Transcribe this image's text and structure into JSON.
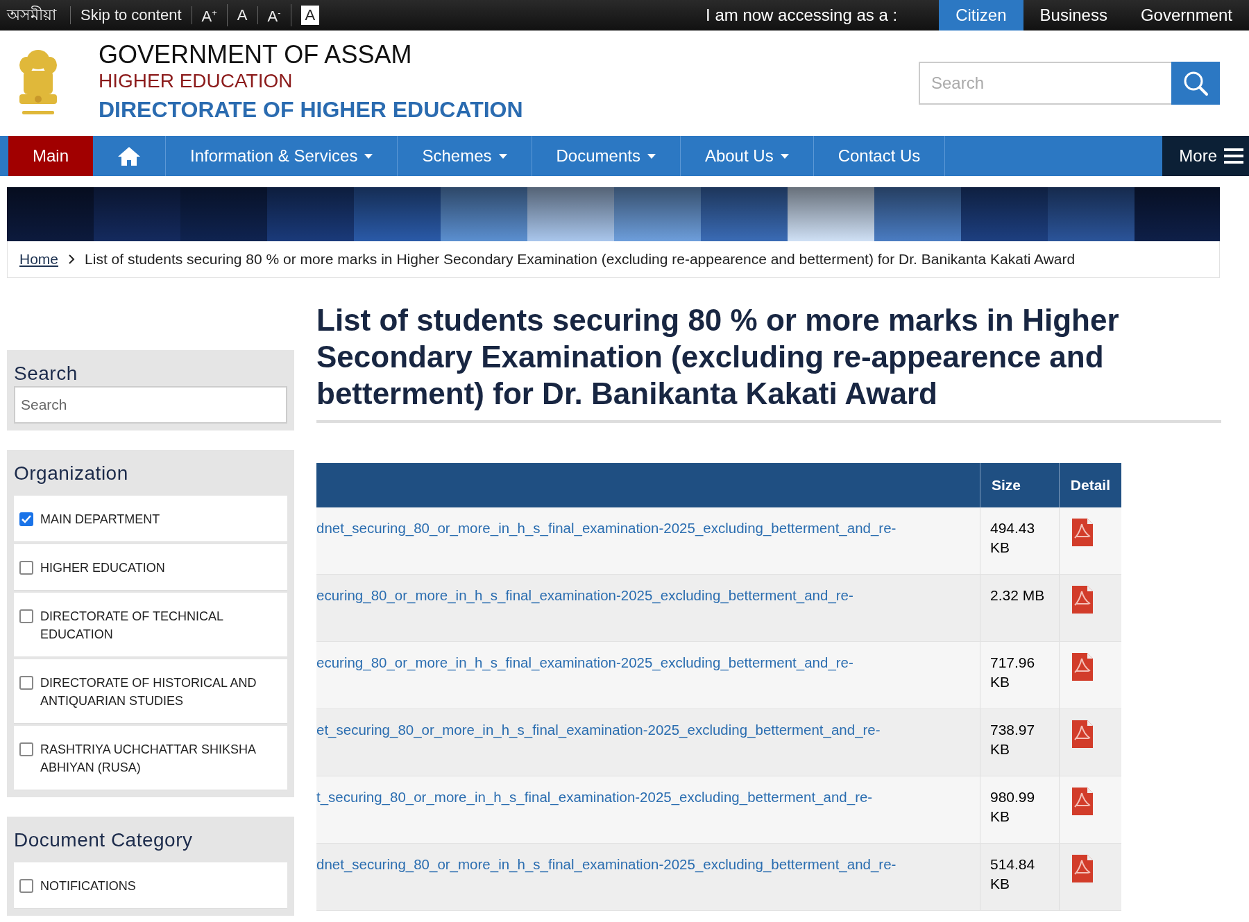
{
  "top_bar": {
    "language": "অসমীয়া",
    "skip_link": "Skip to content",
    "font_controls": [
      {
        "label": "A$^{+}$",
        "kind": "plain"
      },
      {
        "label": "A",
        "kind": "plain"
      },
      {
        "label": "A$^{-}$",
        "kind": "plain"
      },
      {
        "label": "A",
        "kind": "contrast"
      }
    ],
    "audience_prompt": "I am now accessing as a :",
    "audiences": [
      {
        "label": "Citizen",
        "selected": true
      },
      {
        "label": "Business",
        "selected": false
      },
      {
        "label": "Government",
        "selected": false
      }
    ]
  },
  "header": {
    "title": "GOVERNMENT OF ASSAM",
    "department": "HIGHER EDUCATION",
    "directorate": "DIRECTORATE OF HIGHER EDUCATION",
    "search": {
      "placeholder": "Search"
    }
  },
  "nav": {
    "items": [
      {
        "kind": "text",
        "label": "Main",
        "selected": true,
        "dropdown": false
      },
      {
        "kind": "home",
        "selected": false,
        "dropdown": false
      },
      {
        "kind": "text",
        "label": "Information & Services",
        "selected": false,
        "dropdown": true
      },
      {
        "kind": "text",
        "label": "Schemes",
        "selected": false,
        "dropdown": true
      },
      {
        "kind": "text",
        "label": "Documents",
        "selected": false,
        "dropdown": true
      },
      {
        "kind": "text",
        "label": "About Us",
        "selected": false,
        "dropdown": true
      },
      {
        "kind": "text",
        "label": "Contact Us",
        "selected": false,
        "dropdown": false
      }
    ],
    "more": "More"
  },
  "breadcrumb": {
    "home": "Home",
    "current": "List of students securing 80 % or more marks in Higher Secondary Examination (excluding re-appearence and betterment) for Dr. Banikanta Kakati Award"
  },
  "sidebar": {
    "search": {
      "heading": "Search",
      "placeholder": "Search"
    },
    "organization": {
      "heading": "Organization",
      "items": [
        {
          "label": "MAIN DEPARTMENT",
          "checked": true
        },
        {
          "label": "HIGHER EDUCATION",
          "checked": false
        },
        {
          "label": "DIRECTORATE OF TECHNICAL EDUCATION",
          "checked": false
        },
        {
          "label": "DIRECTORATE OF HISTORICAL AND ANTIQUARIAN STUDIES",
          "checked": false
        },
        {
          "label": "RASHTRIYA UCHCHATTAR SHIKSHA ABHIYAN (RUSA)",
          "checked": false
        }
      ]
    },
    "document_category": {
      "heading": "Document Category",
      "items": [
        {
          "label": "NOTIFICATIONS",
          "checked": false
        }
      ]
    }
  },
  "page_title": "List of students securing 80 % or more marks in Higher Secondary Examination (excluding re-appearence and betterment) for Dr. Banikanta Kakati Award",
  "table": {
    "columns": [
      "Size",
      "Detail"
    ],
    "rows": [
      {
        "file": "dnet_securing_80_or_more_in_h_s_final_examination-2025_excluding_betterment_and_re-",
        "size": "494.43 KB"
      },
      {
        "file": "ecuring_80_or_more_in_h_s_final_examination-2025_excluding_betterment_and_re-",
        "size": "2.32 MB"
      },
      {
        "file": "ecuring_80_or_more_in_h_s_final_examination-2025_excluding_betterment_and_re-",
        "size": "717.96 KB"
      },
      {
        "file": "et_securing_80_or_more_in_h_s_final_examination-2025_excluding_betterment_and_re-",
        "size": "738.97 KB"
      },
      {
        "file": "t_securing_80_or_more_in_h_s_final_examination-2025_excluding_betterment_and_re-",
        "size": "980.99 KB"
      },
      {
        "file": "dnet_securing_80_or_more_in_h_s_final_examination-2025_excluding_betterment_and_re-",
        "size": "514.84 KB"
      }
    ]
  }
}
